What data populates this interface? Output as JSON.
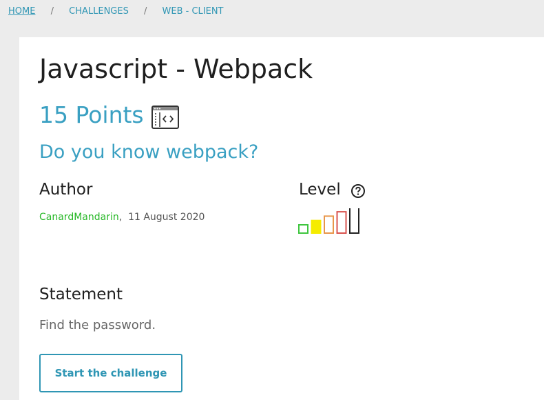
{
  "breadcrumb": {
    "home": "HOME",
    "separator": "/",
    "challenges": "CHALLENGES",
    "category": "WEB - CLIENT"
  },
  "challenge": {
    "title": "Javascript - Webpack",
    "points": "15 Points",
    "points_icon": "browser-code-icon",
    "subtitle": "Do you know webpack?"
  },
  "author": {
    "heading": "Author",
    "name": "CanardMandarin",
    "separator": ",",
    "date": "11 August 2020"
  },
  "level": {
    "heading": "Level",
    "help_icon": "question-circle-icon",
    "scale_levels": 5,
    "current_level": 2,
    "colors": [
      "#3fc63f",
      "#f5ec00",
      "#e8964a",
      "#d9534f",
      "#222222"
    ]
  },
  "statement": {
    "heading": "Statement",
    "text": "Find the password."
  },
  "actions": {
    "start_label": "Start the challenge"
  },
  "colors": {
    "accent": "#3aa0c2",
    "author": "#28b828",
    "background": "#ececec",
    "card": "#ffffff"
  }
}
